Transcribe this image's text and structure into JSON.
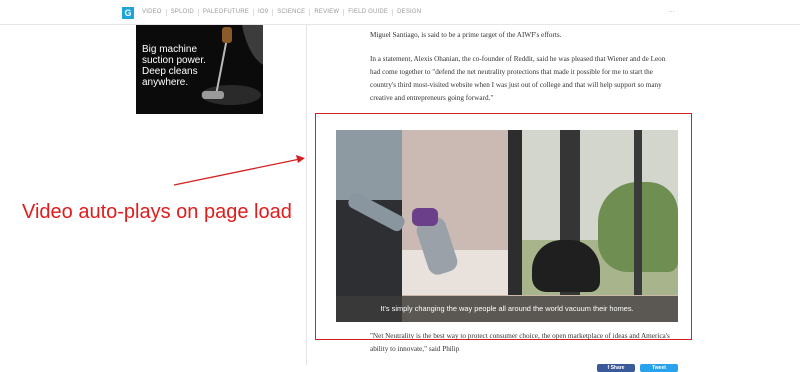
{
  "nav": {
    "logo": "G",
    "items": [
      "VIDEO",
      "SPLOID",
      "PALEOFUTURE",
      "IO9",
      "SCIENCE",
      "REVIEW",
      "FIELD GUIDE",
      "DESIGN"
    ],
    "right_glyph": "⋯"
  },
  "ad": {
    "lines": [
      "Big machine",
      "suction power.",
      "Deep cleans",
      "anywhere."
    ]
  },
  "article": {
    "p1": "Miguel Santiago, is said to be a prime target of the AIWF's efforts.",
    "p2": "In a statement, Alexis Ohanian, the co-founder of Reddit, said he was pleased that Wiener and de Leon had come together to \"defend the net neutrality protections that made it possible for me to start the country's third most-visited website when I was just out of college and that will help support so many creative and entrepreneurs going forward.\"",
    "p3": "\"Net Neutrality is the best way to protect consumer choice, the open marketplace of ideas and America's ability to innovate,\" said Philip"
  },
  "video": {
    "caption": "It's simply changing the way people all around the world vacuum their homes."
  },
  "annotation": {
    "label": "Video auto-plays on page load",
    "color": "#e01c1c"
  },
  "share": {
    "facebook_label": "f Share",
    "twitter_label": "Tweet"
  }
}
